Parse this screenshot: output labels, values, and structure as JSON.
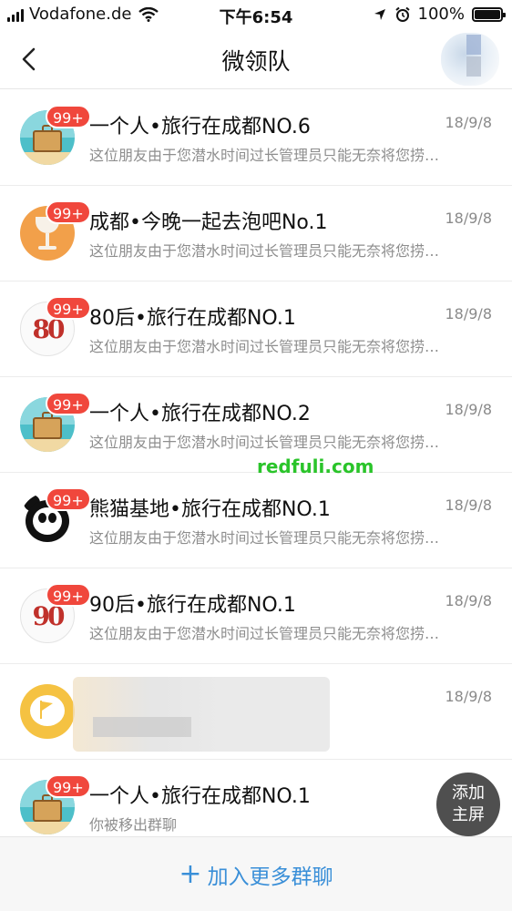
{
  "status_bar": {
    "carrier": "Vodafone.de",
    "time": "下午6:54",
    "battery": "100%",
    "battery_level": 1.0
  },
  "nav": {
    "title": "微领队",
    "back_icon": "chevron-left-icon"
  },
  "groups": [
    {
      "name": "一个人•旅行在成都NO.6",
      "date": "18/9/8",
      "preview": "这位朋友由于您潜水时间过长管理员只能无奈将您捞…",
      "badge": "99+",
      "avatar": "travel"
    },
    {
      "name": "成都•今晚一起去泡吧No.1",
      "date": "18/9/8",
      "preview": "这位朋友由于您潜水时间过长管理员只能无奈将您捞…",
      "badge": "99+",
      "avatar": "bar"
    },
    {
      "name": "80后•旅行在成都NO.1",
      "date": "18/9/8",
      "preview": "这位朋友由于您潜水时间过长管理员只能无奈将您捞…",
      "badge": "99+",
      "avatar": "num80",
      "avatar_text": "80"
    },
    {
      "name": "一个人•旅行在成都NO.2",
      "date": "18/9/8",
      "preview": "这位朋友由于您潜水时间过长管理员只能无奈将您捞…",
      "badge": "99+",
      "avatar": "travel"
    },
    {
      "name": "熊猫基地•旅行在成都NO.1",
      "date": "18/9/8",
      "preview": "这位朋友由于您潜水时间过长管理员只能无奈将您捞…",
      "badge": "99+",
      "avatar": "panda"
    },
    {
      "name": "90后•旅行在成都NO.1",
      "date": "18/9/8",
      "preview": "这位朋友由于您潜水时间过长管理员只能无奈将您捞…",
      "badge": "99+",
      "avatar": "num90",
      "avatar_text": "90"
    },
    {
      "name": "",
      "date": "18/9/8",
      "preview": "",
      "badge": "",
      "avatar": "flag"
    },
    {
      "name": "一个人•旅行在成都NO.1",
      "date": "",
      "preview": "你被移出群聊",
      "badge": "99+",
      "avatar": "travel"
    }
  ],
  "watermark": "redfuli.com",
  "float_button": {
    "line1": "添加",
    "line2": "主屏"
  },
  "bottom": {
    "join_label": "加入更多群聊",
    "plus": "+"
  },
  "colors": {
    "badge": "#f0473c",
    "accent": "#3a8fd8",
    "watermark": "#2ac42a"
  }
}
